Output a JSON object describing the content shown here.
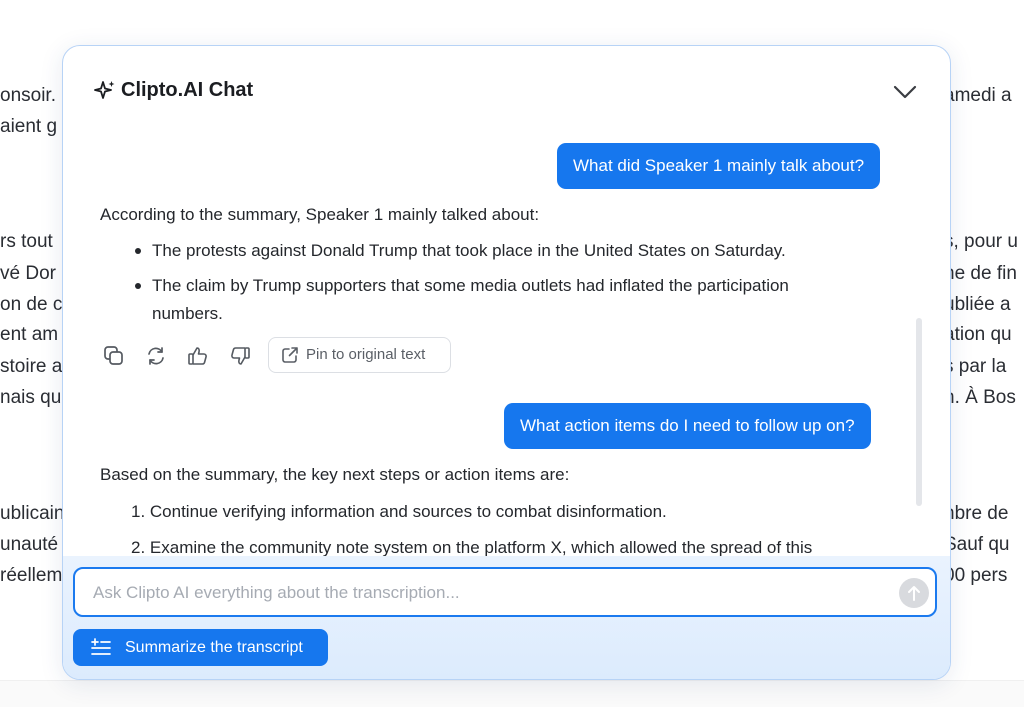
{
  "background": {
    "left_lines": [
      "onsoir.",
      "aient g",
      "rs tout",
      "vé Dor",
      "on de c",
      "ent am",
      "stoire a",
      "nais qu",
      "ublicain",
      "unauté",
      "réellem"
    ],
    "right_lines": [
      "amedi a",
      "s, pour u",
      "ne de fin",
      "ubliée a",
      "ation qu",
      "s par la",
      "n. À Bos",
      "nbre de",
      "Sauf qu",
      "00 pers"
    ]
  },
  "chat": {
    "title": "Clipto.AI Chat",
    "messages": {
      "user_1": "What did Speaker 1 mainly talk about?",
      "ai_1_intro": "According to the summary, Speaker 1 mainly talked about:",
      "ai_1_bullets": [
        "The protests against Donald Trump that took place in the United States on Saturday.",
        "The claim by Trump supporters that some media outlets had inflated the participation",
        "numbers."
      ],
      "pin_label": "Pin to original text",
      "user_2": "What action items do I need to follow up on?",
      "ai_2_intro": "Based on the summary, the key next steps or action items are:",
      "ai_2_items": [
        "1. Continue verifying information and sources to combat disinformation.",
        "2. Examine the community note system on the platform X, which allowed the spread of this"
      ]
    },
    "input_placeholder": "Ask Clipto AI everything about the transcription...",
    "summarize_label": "Summarize the transcript",
    "icons": [
      "sparkle-icon",
      "chevron-down-icon",
      "copy-icon",
      "refresh-icon",
      "thumbs-up-icon",
      "thumbs-down-icon",
      "external-link-icon",
      "send-arrow-icon",
      "summarize-icon"
    ]
  },
  "colors": {
    "accent": "#1677ee",
    "panel_border": "#b7d3f6",
    "footer_bg": "#e3effd"
  }
}
